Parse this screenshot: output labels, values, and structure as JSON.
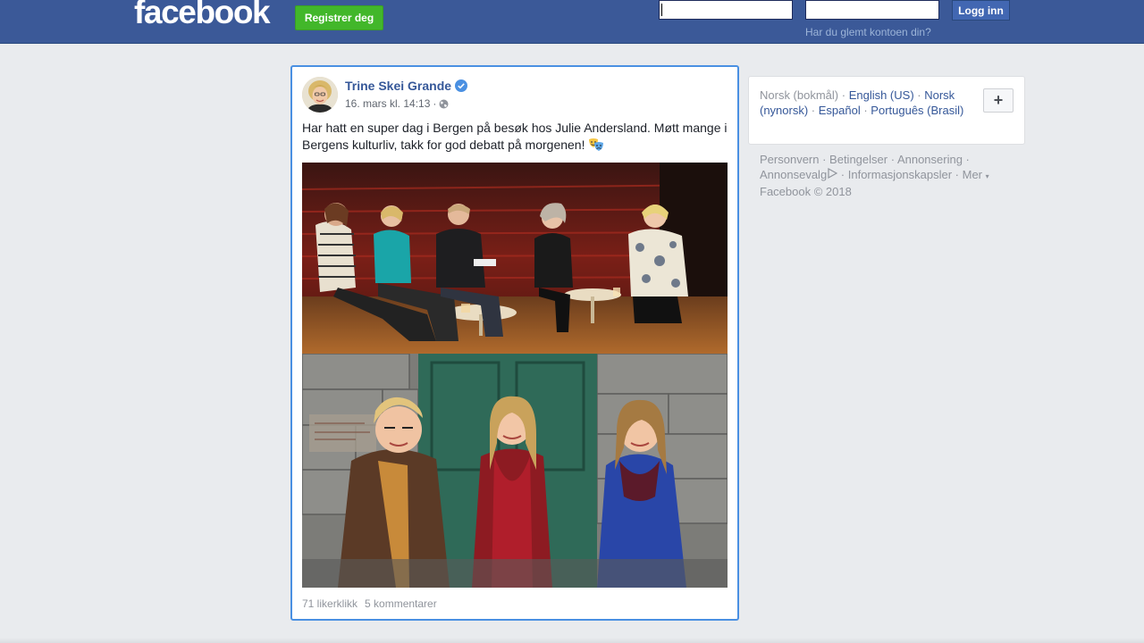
{
  "header": {
    "logo_text": "facebook",
    "register_label": "Registrer deg",
    "email_value": "",
    "password_value": "",
    "login_label": "Logg inn",
    "forgot_label": "Har du glemt kontoen din?",
    "brand_color": "#3b5998"
  },
  "post": {
    "author": "Trine Skei Grande",
    "verified_icon": "verified-badge-icon",
    "date": "16. mars kl. 14:13",
    "separator": "·",
    "audience_icon": "globe-icon",
    "text": "Har hatt en super dag i Bergen på besøk hos Julie Andersland. Møtt mange i Bergens kulturliv, takk for god debatt på morgenen!",
    "emoji_icon": "theater-masks-icon",
    "likes": "71 likerklikk",
    "comments": "5 kommentarer"
  },
  "languages": {
    "current": "Norsk (bokmål)",
    "items": [
      "English (US)",
      "Norsk (nynorsk)",
      "Español",
      "Português (Brasil)"
    ],
    "add_label": "+"
  },
  "footer": {
    "links": [
      "Personvern",
      "Betingelser",
      "Annonsering",
      "Annonsevalg",
      "Informasjonskapsler",
      "Mer"
    ],
    "copyright": "Facebook © 2018"
  }
}
